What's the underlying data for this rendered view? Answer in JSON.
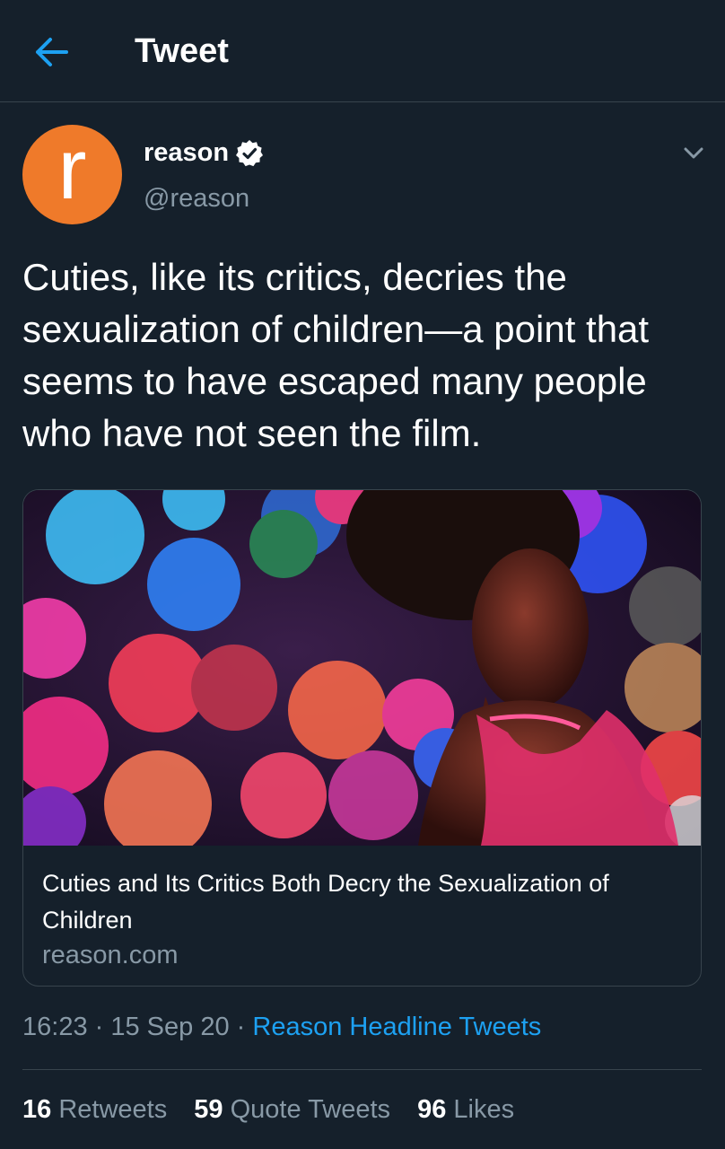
{
  "header": {
    "title": "Tweet",
    "back_icon": "arrow-left-icon",
    "accent": "#1da1f2"
  },
  "author": {
    "avatar_letter": "r",
    "avatar_color": "#ef7a2a",
    "display_name": "reason",
    "handle": "@reason",
    "verified_icon": "verified-badge-icon"
  },
  "menu_icon": "chevron-down-icon",
  "tweet": {
    "text": "Cuties, like its critics, decries the sexualization of children—a point that seems to have escaped many people who have not seen the film."
  },
  "card": {
    "title": "Cuties and Its Critics Both Decry the Sexualization of Children",
    "domain": "reason.com"
  },
  "meta": {
    "time": "16:23",
    "sep1": " · ",
    "date": "15 Sep 20",
    "sep2": " · ",
    "source": "Reason Headline Tweets"
  },
  "stats": {
    "retweets": {
      "count": "16",
      "label": "Retweets"
    },
    "quotes": {
      "count": "59",
      "label": "Quote Tweets"
    },
    "likes": {
      "count": "96",
      "label": "Likes"
    }
  }
}
